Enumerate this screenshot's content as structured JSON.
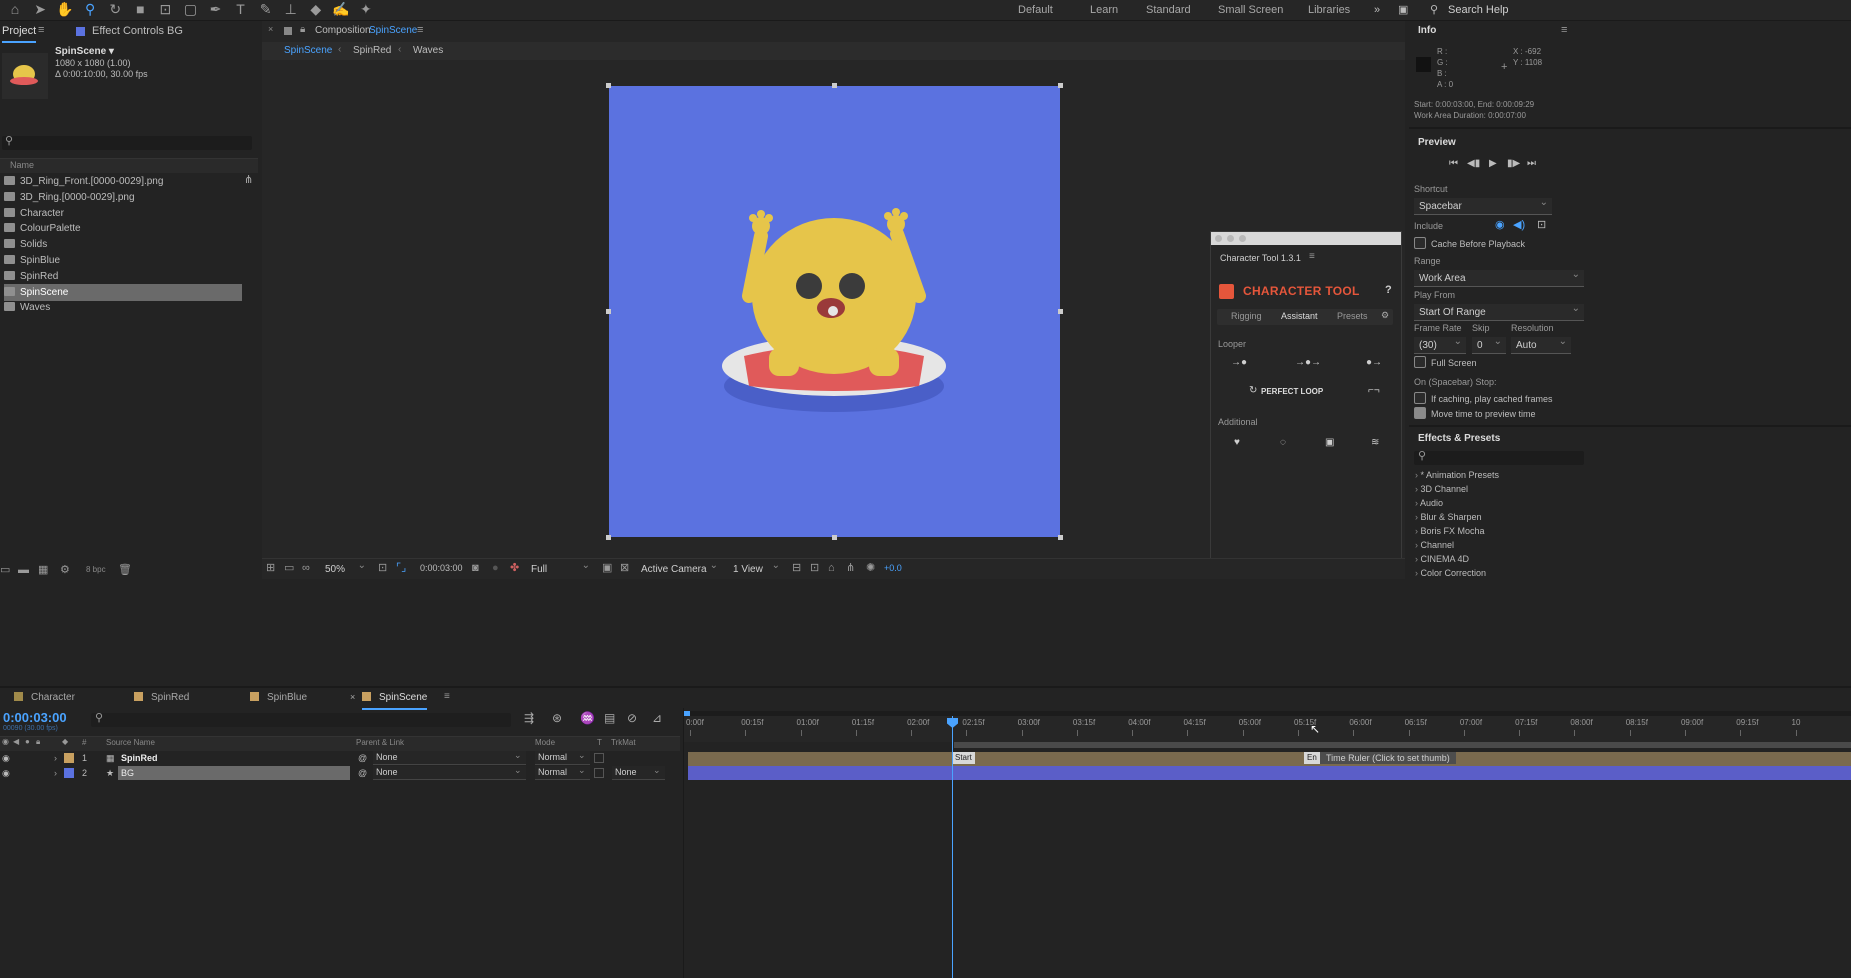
{
  "workspaces": [
    "Default",
    "Learn",
    "Standard",
    "Small Screen",
    "Libraries"
  ],
  "search_help": "Search Help",
  "project": {
    "tab_project": "Project",
    "tab_effects": "Effect Controls BG",
    "comp_name": "SpinScene ▾",
    "comp_size": "1080 x 1080 (1.00)",
    "comp_duration": "Δ 0:00:10:00, 30.00 fps",
    "col_name": "Name",
    "items": [
      "3D_Ring_Front.[0000-0029].png",
      "3D_Ring.[0000-0029].png",
      "Character",
      "ColourPalette",
      "Solids",
      "SpinBlue",
      "SpinRed",
      "SpinScene",
      "Waves"
    ],
    "selected_index": 7,
    "bpc": "8 bpc"
  },
  "composition": {
    "tab_prefix": "Composition",
    "tab_name": "SpinScene",
    "crumbs": [
      "SpinScene",
      "SpinRed",
      "Waves"
    ],
    "canvas_color": "#5b72e0",
    "zoom": "50%",
    "timecode": "0:00:03:00",
    "resolution": "Full",
    "camera": "Active Camera",
    "views": "1 View",
    "exposure": "+0.0"
  },
  "character_tool": {
    "panel_title": "Character Tool 1.3.1",
    "brand": "CHARACTER TOOL",
    "help": "?",
    "tabs": [
      "Rigging",
      "Assistant",
      "Presets"
    ],
    "active_tab": 1,
    "section_looper": "Looper",
    "perfect_loop": "PERFECT LOOP",
    "section_additional": "Additional"
  },
  "info": {
    "title": "Info",
    "r": "R :",
    "g": "G :",
    "b": "B :",
    "a": "A : 0",
    "x": "X : -692",
    "y": "Y : 1108",
    "start_end": "Start: 0:00:03:00, End: 0:00:09:29",
    "work_area": "Work Area Duration: 0:00:07:00"
  },
  "preview": {
    "title": "Preview",
    "shortcut_label": "Shortcut",
    "shortcut_value": "Spacebar",
    "include_label": "Include",
    "cache_before": "Cache Before Playback",
    "range_label": "Range",
    "range_value": "Work Area",
    "play_from_label": "Play From",
    "play_from_value": "Start Of Range",
    "frame_rate_label": "Frame Rate",
    "skip_label": "Skip",
    "resolution_label": "Resolution",
    "frame_rate_value": "(30)",
    "skip_value": "0",
    "resolution_value": "Auto",
    "full_screen": "Full Screen",
    "on_stop": "On (Spacebar) Stop:",
    "if_caching": "If caching, play cached frames",
    "move_time": "Move time to preview time"
  },
  "effects": {
    "title": "Effects & Presets",
    "items": [
      "* Animation Presets",
      "3D Channel",
      "Audio",
      "Blur & Sharpen",
      "Boris FX Mocha",
      "Channel",
      "CINEMA 4D",
      "Color Correction"
    ]
  },
  "timeline": {
    "tabs": [
      "Character",
      "SpinRed",
      "SpinBlue",
      "SpinScene"
    ],
    "active_tab": 3,
    "tab_colors": [
      "#a08a4a",
      "#c8a060",
      "#c8a060",
      "#c8a060"
    ],
    "timecode": "0:00:03:00",
    "timecode_sub": "00090 (30.00 fps)",
    "col_source": "Source Name",
    "col_parent": "Parent & Link",
    "col_mode": "Mode",
    "col_t": "T",
    "col_trkmat": "TrkMat",
    "layers": [
      {
        "num": "1",
        "name": "SpinRed",
        "parent": "None",
        "mode": "Normal",
        "trkmat": "",
        "color": "#c8a060"
      },
      {
        "num": "2",
        "name": "BG",
        "parent": "None",
        "mode": "Normal",
        "trkmat": "None",
        "color": "#5b72e0"
      }
    ],
    "ruler": [
      "0:00f",
      "00:15f",
      "01:00f",
      "01:15f",
      "02:00f",
      "02:15f",
      "03:00f",
      "03:15f",
      "04:00f",
      "04:15f",
      "05:00f",
      "05:15f",
      "06:00f",
      "06:15f",
      "07:00f",
      "07:15f",
      "08:00f",
      "08:15f",
      "09:00f",
      "09:15f",
      "10"
    ],
    "marker_label": "Start",
    "marker2_label": "En",
    "tooltip": "Time Ruler (Click to set thumb)"
  }
}
